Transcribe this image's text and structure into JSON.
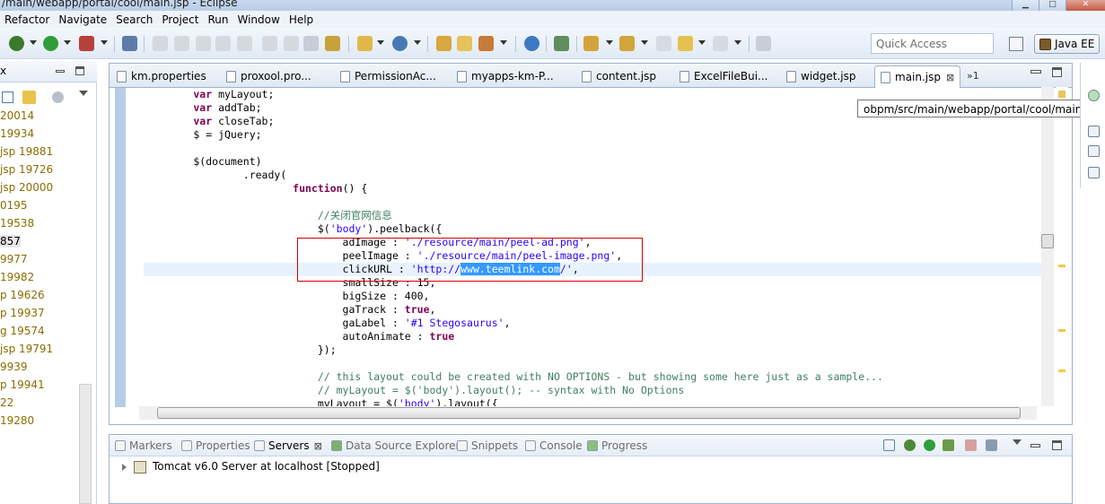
{
  "window": {
    "title": "/main/webapp/portal/cool/main.jsp - Eclipse"
  },
  "menu": [
    "Refactor",
    "Navigate",
    "Search",
    "Project",
    "Run",
    "Window",
    "Help"
  ],
  "quick_access": {
    "placeholder": "Quick Access"
  },
  "perspective": {
    "label": "Java EE"
  },
  "left_panel": {
    "items": [
      "20014",
      " 19934",
      "jsp 19881",
      "jsp 19726",
      "jsp 20000",
      "0195",
      "19538",
      "857",
      "9977",
      "19982",
      "p 19626",
      "p 19937",
      "g 19574",
      "jsp 19791",
      "9939",
      "p 19941",
      "22",
      "19280"
    ],
    "selected_index": 7
  },
  "editor": {
    "tabs": [
      {
        "label": "km.properties"
      },
      {
        "label": "proxool.pro..."
      },
      {
        "label": "PermissionAc..."
      },
      {
        "label": "myapps-km-P..."
      },
      {
        "label": "content.jsp"
      },
      {
        "label": "ExcelFileBui..."
      },
      {
        "label": "widget.jsp"
      },
      {
        "label": "main.jsp",
        "active": true
      }
    ],
    "overflow_count": "»1",
    "close_glyph": "⊠",
    "tooltip": "obpm/src/main/webapp/portal/cool/main.jsp",
    "code_lines": [
      [
        {
          "k": "kw",
          "t": "        var"
        },
        {
          "t": " myLayout;"
        }
      ],
      [
        {
          "k": "kw",
          "t": "        var"
        },
        {
          "t": " addTab;"
        }
      ],
      [
        {
          "k": "kw",
          "t": "        var"
        },
        {
          "t": " closeTab;"
        }
      ],
      [
        {
          "t": "        $ = jQuery;"
        }
      ],
      [
        {
          "t": ""
        }
      ],
      [
        {
          "t": "        $(document)"
        }
      ],
      [
        {
          "t": "                .ready("
        }
      ],
      [
        {
          "k": "kw",
          "t": "                        function"
        },
        {
          "t": "() {"
        }
      ],
      [
        {
          "t": ""
        }
      ],
      [
        {
          "k": "cm",
          "t": "                            //关闭官网信息"
        }
      ],
      [
        {
          "t": "                            $("
        },
        {
          "k": "str",
          "t": "'body'"
        },
        {
          "t": ").peelback({"
        }
      ],
      [
        {
          "t": "                                adImage : "
        },
        {
          "k": "str",
          "t": "'./resource/main/peel-ad.png'"
        },
        {
          "t": ","
        }
      ],
      [
        {
          "t": "                                peelImage : "
        },
        {
          "k": "str",
          "t": "'./resource/main/peel-image.png'"
        },
        {
          "t": ","
        }
      ],
      [
        {
          "t": "                                clickURL : "
        },
        {
          "k": "str",
          "t": "'http://"
        },
        {
          "k": "hl",
          "t": "www.teemlink.com"
        },
        {
          "k": "str",
          "t": "/'"
        },
        {
          "t": ","
        }
      ],
      [
        {
          "t": "                                smallSize : 15,"
        }
      ],
      [
        {
          "t": "                                bigSize : 400,"
        }
      ],
      [
        {
          "t": "                                gaTrack : "
        },
        {
          "k": "kw",
          "t": "true"
        },
        {
          "t": ","
        }
      ],
      [
        {
          "t": "                                gaLabel : "
        },
        {
          "k": "str",
          "t": "'#1 Stegosaurus'"
        },
        {
          "t": ","
        }
      ],
      [
        {
          "t": "                                autoAnimate : "
        },
        {
          "k": "kw",
          "t": "true"
        }
      ],
      [
        {
          "t": "                            });"
        }
      ],
      [
        {
          "t": ""
        }
      ],
      [
        {
          "k": "cm",
          "t": "                            // this layout could be created with NO OPTIONS - but showing some here just as a sample..."
        }
      ],
      [
        {
          "k": "cm",
          "t": "                            // myLayout = $('body').layout(); -- syntax with No Options"
        }
      ],
      [
        {
          "t": "                            myLayout = $("
        },
        {
          "k": "str",
          "t": "'body'"
        },
        {
          "t": ").layout({"
        }
      ]
    ]
  },
  "bottom_panel": {
    "tabs": [
      {
        "label": "Markers"
      },
      {
        "label": "Properties"
      },
      {
        "label": "Servers",
        "active": true
      },
      {
        "label": "Data Source Explorer"
      },
      {
        "label": "Snippets"
      },
      {
        "label": "Console"
      },
      {
        "label": "Progress"
      }
    ],
    "server": "Tomcat v6.0 Server at localhost  [Stopped]"
  }
}
